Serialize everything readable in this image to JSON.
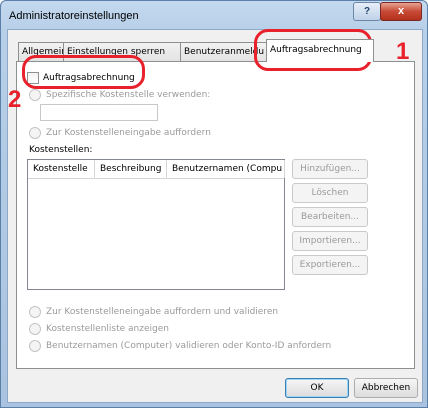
{
  "window": {
    "title": "Administratoreinstellungen",
    "help_label": "?",
    "close_label": "x"
  },
  "tabs": [
    {
      "label": "Allgemein"
    },
    {
      "label": "Einstellungen sperren"
    },
    {
      "label": "Benutzeranmeldu"
    },
    {
      "label": "Auftragsabrechnung"
    }
  ],
  "panel": {
    "job_accounting_checkbox": {
      "label": "Auftragsabrechnung",
      "checked": false
    },
    "specific_cost_center": {
      "label": "Spezifische Kostenstelle verwenden:",
      "value": ""
    },
    "prompt_cost_center": {
      "label": "Zur Kostenstelleneingabe auffordern"
    },
    "cost_centers_label": "Kostenstellen:",
    "columns": [
      "Kostenstelle",
      "Beschreibung",
      "Benutzernamen (Compu"
    ],
    "buttons": {
      "add": "Hinzufügen...",
      "delete": "Löschen",
      "edit": "Bearbeiten...",
      "import": "Importieren...",
      "export": "Exportieren..."
    },
    "prompt_validate": {
      "label": "Zur Kostenstelleneingabe auffordern und validieren"
    },
    "show_list": {
      "label": "Kostenstellenliste anzeigen"
    },
    "validate_user": {
      "label": "Benutzernamen (Computer) validieren oder Konto-ID anfordern"
    }
  },
  "footer": {
    "ok": "OK",
    "cancel": "Abbrechen"
  },
  "annotations": {
    "step1": "1",
    "step2": "2"
  },
  "colors": {
    "callout": "#e8212b",
    "title_gradient": "#b7cfe8",
    "close_red": "#c74a36"
  }
}
